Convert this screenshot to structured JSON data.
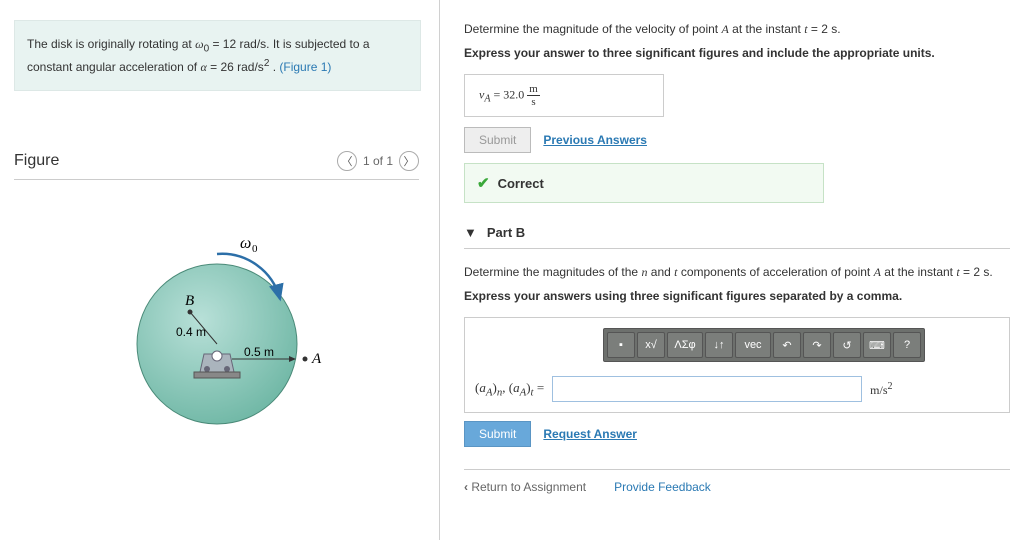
{
  "problem": {
    "text_1": "The disk is originally rotating at ",
    "w0": "ω",
    "w0_sub": "0",
    "w0_val": " = 12  rad/s",
    "text_2": ". It is subjected to a constant angular acceleration of ",
    "alpha": "α",
    "alpha_val": " = 26  rad/s",
    "alpha_exp": "2",
    "text_3": " . ",
    "fig_link": "(Figure 1)"
  },
  "figure": {
    "title": "Figure",
    "pager": "1 of 1",
    "labels": {
      "w0": "ω₀",
      "B": "B",
      "r1": "0.4 m",
      "r2": "0.5 m",
      "A": "A"
    }
  },
  "partA": {
    "prompt_1": "Determine the magnitude of the velocity of point ",
    "A": "A",
    "prompt_2": " at the instant ",
    "t": "t",
    "prompt_3": " = 2 s.",
    "bold": "Express your answer to three significant figures and include the appropriate units.",
    "var": "v",
    "sub": "A",
    "eq": " =  32.0 ",
    "unit_n": "m",
    "unit_d": "s",
    "submit": "Submit",
    "prev": "Previous Answers",
    "correct": "Correct"
  },
  "partB": {
    "header": "Part B",
    "prompt_1": "Determine the magnitudes of the ",
    "n": "n",
    "prompt_2": " and ",
    "t": "t",
    "prompt_3": " components of acceleration of point ",
    "A": "A",
    "prompt_4": " at the instant ",
    "tvar": "t",
    "prompt_5": " = 2 s.",
    "bold": "Express your answers using three significant figures separated by a comma.",
    "toolbar": {
      "templates": "x√",
      "greek": "ΛΣφ",
      "sub": "↓↑",
      "vec": "vec",
      "undo": "↶",
      "redo": "↷",
      "reset": "↺",
      "keyboard": "⌨",
      "help": "?"
    },
    "label_lhs": "(aA)n, (aA)t = ",
    "unit": "m/s²",
    "submit": "Submit",
    "request": "Request Answer"
  },
  "footer": {
    "return": "Return to Assignment",
    "feedback": "Provide Feedback"
  }
}
